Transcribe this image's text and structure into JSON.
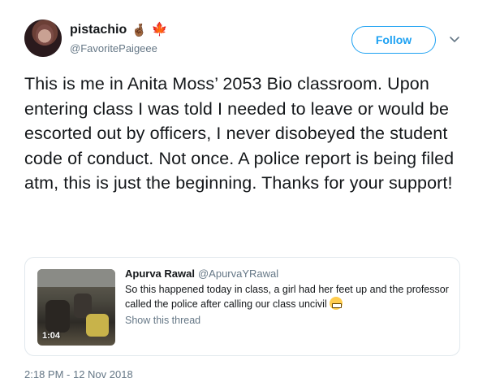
{
  "author": {
    "display_name": "pistachio",
    "emoji_badges": "🤞🏾",
    "emoji_leaf": "🍁",
    "handle": "@FavoritePaigeee"
  },
  "actions": {
    "follow_label": "Follow",
    "menu_icon": "chevron-down-icon"
  },
  "tweet": {
    "text": "This is me in Anita Moss’ 2053 Bio classroom. Upon entering class I was told I needed to leave or would be escorted out by officers, I never disobeyed the student code of conduct. Not once. A police report is being filed atm, this is just the beginning. Thanks for your support!",
    "timestamp": "2:18 PM - 12 Nov 2018"
  },
  "quoted_tweet": {
    "display_name": "Apurva Rawal",
    "handle": "@ApurvaYRawal",
    "text": "So this happened today in class, a girl had her feet up and the professor called the police after calling our class uncivil",
    "emoji": "grimacing-face",
    "show_thread": "Show this thread",
    "video_duration": "1:04"
  },
  "colors": {
    "accent": "#1da1f2",
    "muted": "#657786",
    "text": "#14171a",
    "border": "#e1e8ed"
  }
}
